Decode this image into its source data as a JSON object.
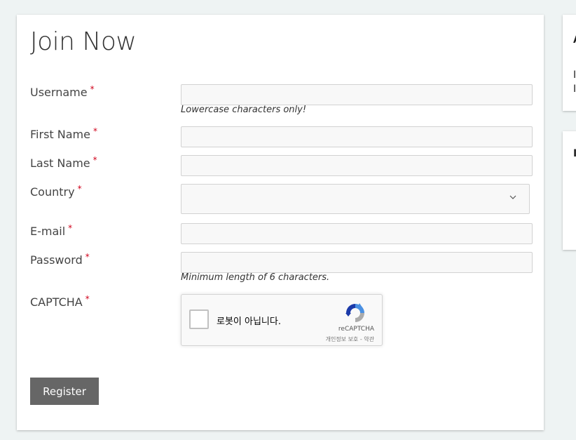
{
  "form": {
    "title": "Join Now",
    "required_mark": "*",
    "fields": {
      "username": {
        "label": "Username",
        "value": "",
        "hint": "Lowercase characters only!"
      },
      "first_name": {
        "label": "First Name",
        "value": ""
      },
      "last_name": {
        "label": "Last Name",
        "value": ""
      },
      "country": {
        "label": "Country",
        "selected": ""
      },
      "email": {
        "label": "E-mail",
        "value": ""
      },
      "password": {
        "label": "Password",
        "value": "",
        "hint": "Minimum length of 6 characters."
      },
      "captcha": {
        "label": "CAPTCHA"
      }
    },
    "submit_label": "Register"
  },
  "recaptcha": {
    "checkbox_text": "로봇이 아닙니다.",
    "brand": "reCAPTCHA",
    "privacy_terms": "개인정보 보호 - 약관",
    "logo_colors": [
      "#1c3aa9",
      "#4a90e2",
      "#ababab"
    ]
  },
  "sidebar": {
    "card1_peek": "A",
    "card1_line1": "I",
    "card1_line2": "I",
    "card2_peek": "I"
  },
  "colors": {
    "background": "#eef3f3",
    "required": "#d0021b",
    "button": "#666666"
  }
}
